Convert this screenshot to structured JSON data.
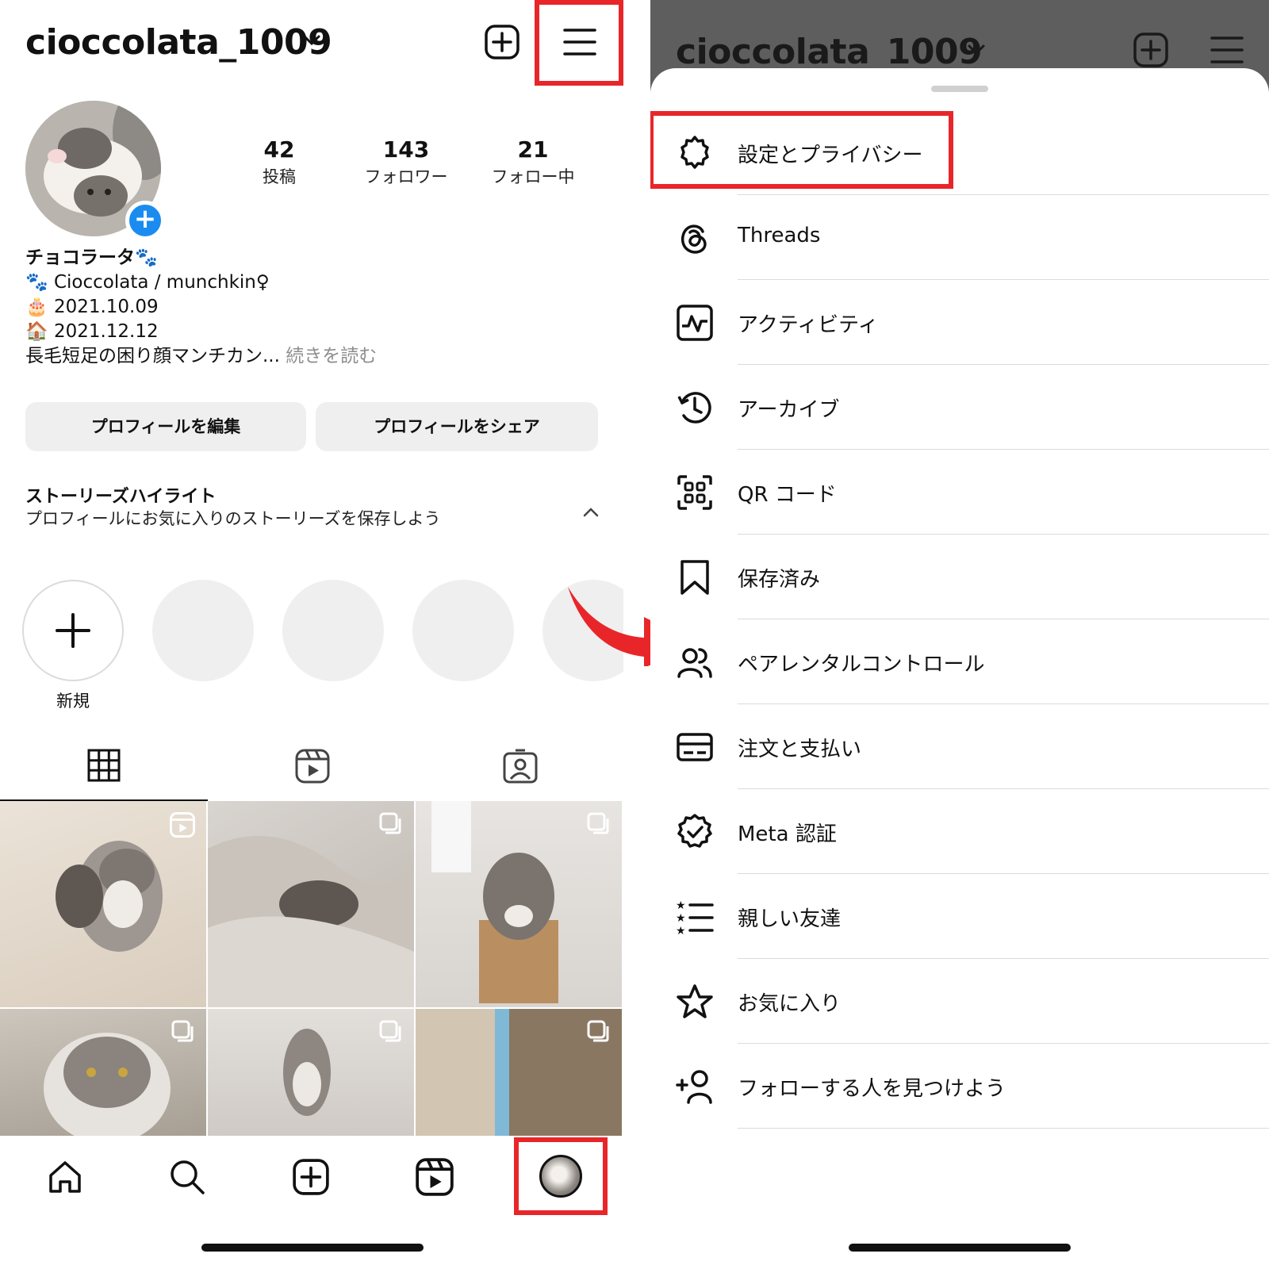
{
  "left": {
    "header": {
      "username": "cioccolata_1009"
    },
    "stats": [
      {
        "value": "42",
        "label": "投稿"
      },
      {
        "value": "143",
        "label": "フォロワー"
      },
      {
        "value": "21",
        "label": "フォロー中"
      }
    ],
    "bio": {
      "name": "チョコラータ🐾",
      "line1": "🐾 Cioccolata / munchkin♀",
      "line2": "🎂 2021.10.09",
      "line3": "🏠 2021.12.12",
      "line4": "長毛短足の困り顔マンチカン...",
      "more": " 続きを読む"
    },
    "buttons": {
      "edit": "プロフィールを編集",
      "share": "プロフィールをシェア"
    },
    "highlights": {
      "title": "ストーリーズハイライト",
      "subtitle": "プロフィールにお気に入りのストーリーズを保存しよう",
      "new_label": "新規"
    }
  },
  "right": {
    "header": {
      "username": "cioccolata_1009"
    },
    "menu": [
      {
        "label": "設定とプライバシー",
        "icon": "gear-icon"
      },
      {
        "label": "Threads",
        "icon": "threads-icon"
      },
      {
        "label": "アクティビティ",
        "icon": "activity-icon"
      },
      {
        "label": "アーカイブ",
        "icon": "archive-icon"
      },
      {
        "label": "QR コード",
        "icon": "qr-code-icon"
      },
      {
        "label": "保存済み",
        "icon": "bookmark-icon"
      },
      {
        "label": "ペアレンタルコントロール",
        "icon": "people-icon"
      },
      {
        "label": "注文と支払い",
        "icon": "card-icon"
      },
      {
        "label": "Meta 認証",
        "icon": "verified-icon"
      },
      {
        "label": "親しい友達",
        "icon": "close-friends-icon"
      },
      {
        "label": "お気に入り",
        "icon": "star-icon"
      },
      {
        "label": "フォローする人を見つけよう",
        "icon": "add-person-icon"
      }
    ]
  },
  "colors": {
    "highlight": "#e8262a",
    "accent": "#1a8cf0"
  }
}
